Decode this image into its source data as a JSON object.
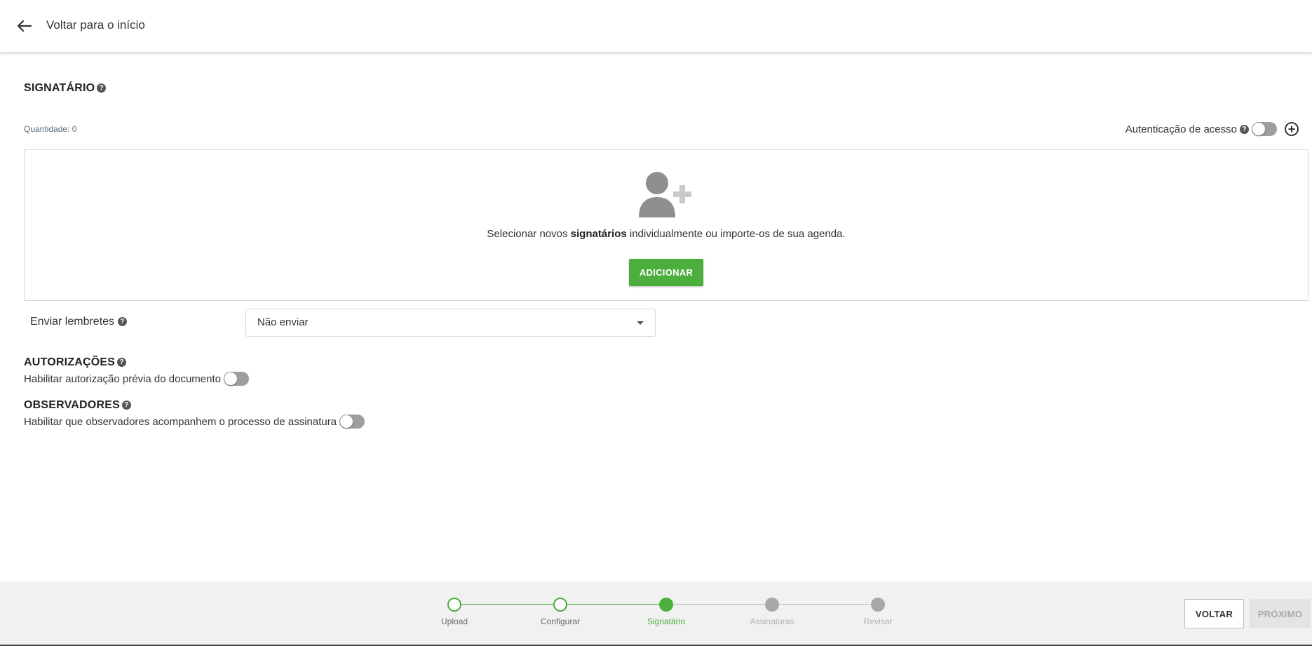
{
  "header": {
    "back_label": "Voltar para o início"
  },
  "signatario": {
    "title": "SIGNATÁRIO",
    "quantity_text": "Quantidade: 0",
    "auth_label": "Autenticação de acesso",
    "empty_text_prefix": "Selecionar novos ",
    "empty_text_bold": "signatários",
    "empty_text_suffix": " individualmente ou importe-os de sua agenda.",
    "add_button": "ADICIONAR"
  },
  "reminders": {
    "label": "Enviar lembretes",
    "selected": "Não enviar"
  },
  "autorizacoes": {
    "title": "AUTORIZAÇÕES",
    "toggle_label": "Habilitar autorização prévia do documento"
  },
  "observadores": {
    "title": "OBSERVADORES",
    "toggle_label": "Habilitar que observadores acompanhem o processo de assinatura"
  },
  "stepper": {
    "steps": [
      {
        "label": "Upload",
        "state": "done"
      },
      {
        "label": "Configurar",
        "state": "done"
      },
      {
        "label": "Signatário",
        "state": "active"
      },
      {
        "label": "Assinaturas",
        "state": "pending"
      },
      {
        "label": "Revisar",
        "state": "pending"
      }
    ]
  },
  "footer": {
    "back_button": "VOLTAR",
    "next_button": "PRÓXIMO"
  },
  "colors": {
    "accent": "#4caf3d",
    "pending": "#a8a8a8",
    "icon_gray": "#8f8f8f"
  }
}
